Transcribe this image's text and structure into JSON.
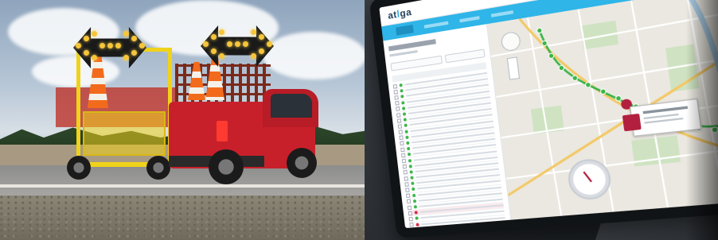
{
  "left_photo": {
    "subject": "arrow-board-trailer-and-pickup-truck"
  },
  "right_photo": {
    "app": {
      "logo_main": "at",
      "logo_accent": "l",
      "logo_end": "ga"
    },
    "colors": {
      "nav": "#2fb5e8",
      "route": "#3cb54a",
      "alert": "#b3203f",
      "truck": "#c8202a",
      "trailer": "#f0d21a"
    }
  }
}
